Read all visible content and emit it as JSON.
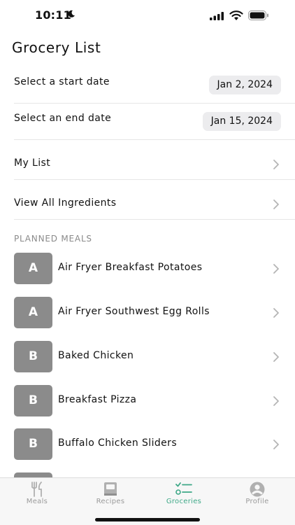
{
  "status_bar": {
    "time": "10:11"
  },
  "header": {
    "title": "Grocery List"
  },
  "dates": {
    "start_label": "Select a start date",
    "start_value": "Jan 2, 2024",
    "end_label": "Select an end date",
    "end_value": "Jan 15, 2024"
  },
  "nav": {
    "my_list": "My List",
    "view_all": "View All Ingredients"
  },
  "planned_meals": {
    "header": "PLANNED MEALS",
    "items": [
      {
        "letter": "A",
        "name": "Air Fryer Breakfast Potatoes"
      },
      {
        "letter": "A",
        "name": "Air Fryer Southwest Egg Rolls"
      },
      {
        "letter": "B",
        "name": "Baked Chicken"
      },
      {
        "letter": "B",
        "name": "Breakfast Pizza"
      },
      {
        "letter": "B",
        "name": "Buffalo Chicken Sliders"
      }
    ]
  },
  "tab_bar": {
    "tabs": [
      {
        "label": "Meals",
        "icon": "fork-knife-icon",
        "active": false
      },
      {
        "label": "Recipes",
        "icon": "book-icon",
        "active": false
      },
      {
        "label": "Groceries",
        "icon": "checklist-icon",
        "active": true
      },
      {
        "label": "Profile",
        "icon": "person-icon",
        "active": false
      }
    ]
  },
  "colors": {
    "accent": "#3ea887",
    "avatar_bg": "#8b8b8b",
    "pill_bg": "#ececee"
  }
}
